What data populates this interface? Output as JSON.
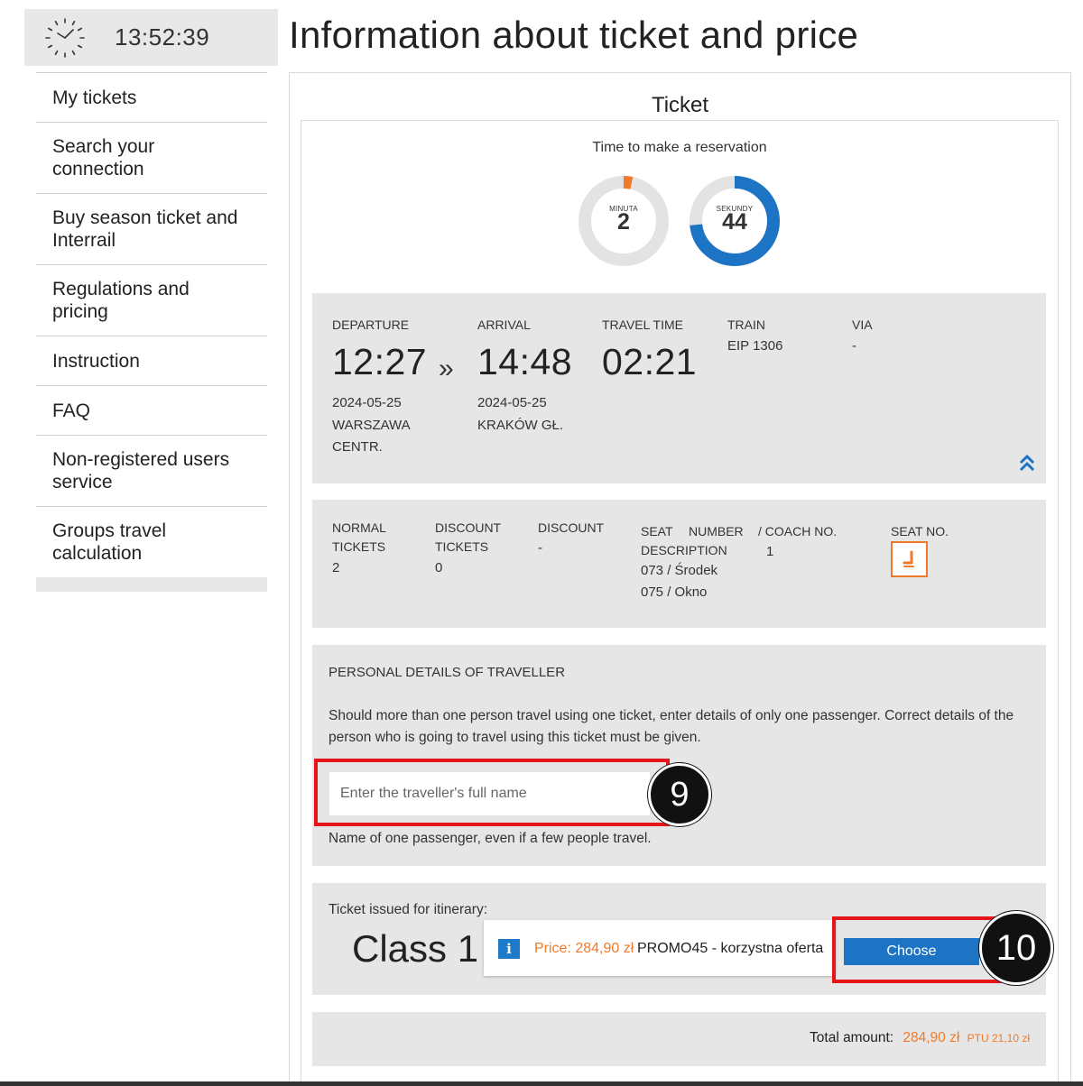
{
  "clock": {
    "time": "13:52:39"
  },
  "sidebar": {
    "items": [
      {
        "label": "My tickets"
      },
      {
        "label": "Search your connection"
      },
      {
        "label": "Buy season ticket and Interrail"
      },
      {
        "label": "Regulations and pricing"
      },
      {
        "label": "Instruction"
      },
      {
        "label": "FAQ"
      },
      {
        "label": "Non-registered users service"
      },
      {
        "label": "Groups travel calculation"
      }
    ]
  },
  "header": {
    "title": "Information about ticket and price"
  },
  "ticket": {
    "heading": "Ticket",
    "timer": {
      "label": "Time to make a reservation",
      "minutes_caption": "MINUTA",
      "minutes_value": "2",
      "minutes_fraction": 0.033,
      "seconds_caption": "SEKUNDY",
      "seconds_value": "44",
      "seconds_fraction": 0.733,
      "minutes_color": "#f07a2a",
      "seconds_color": "#1d74c4"
    },
    "journey": {
      "departure_label": "DEPARTURE",
      "departure_time": "12:27",
      "departure_date": "2024-05-25",
      "departure_station_line1": "WARSZAWA",
      "departure_station_line2": "CENTR.",
      "separator": "»",
      "arrival_label": "ARRIVAL",
      "arrival_time": "14:48",
      "arrival_date": "2024-05-25",
      "arrival_station": "KRAKÓW GŁ.",
      "travel_time_label": "TRAVEL TIME",
      "travel_time": "02:21",
      "train_label": "TRAIN",
      "train": "EIP 1306",
      "via_label": "VIA",
      "via": "-"
    },
    "tickets": {
      "normal_label_1": "NORMAL",
      "normal_label_2": "TICKETS",
      "normal_value": "2",
      "discount_tickets_label_1": "DISCOUNT",
      "discount_tickets_label_2": "TICKETS",
      "discount_tickets_value": "0",
      "discount_label": "DISCOUNT",
      "discount_value": "-",
      "seat_label_1": "SEAT",
      "seat_label_number": "NUMBER",
      "seat_label_2": "DESCRIPTION",
      "seat_1": "073 / Środek",
      "seat_2": "075 / Okno",
      "coach_label": "/ COACH NO.",
      "coach_value": "1",
      "seat_no_label": "SEAT NO."
    },
    "personal": {
      "heading": "PERSONAL DETAILS OF TRAVELLER",
      "description": "Should more than one person travel using one ticket, enter details of only one passenger. Correct details of the person who is going to travel using this ticket must be given.",
      "name_placeholder": "Enter the traveller's full name",
      "hint": "Name of one passenger, even if a few people travel."
    },
    "itinerary": {
      "label": "Ticket issued for itinerary:",
      "class": "Class 1",
      "info_icon": "i",
      "price_label": "Price: 284,90 zł",
      "offer": "PROMO45 - korzystna oferta",
      "choose_label": "Choose"
    },
    "total": {
      "label": "Total amount:",
      "amount": "284,90 zł",
      "vat": "PTU 21,10 zł"
    }
  },
  "annotations": {
    "badge_9": "9",
    "badge_10": "10",
    "highlight_color": "#e8141b"
  }
}
